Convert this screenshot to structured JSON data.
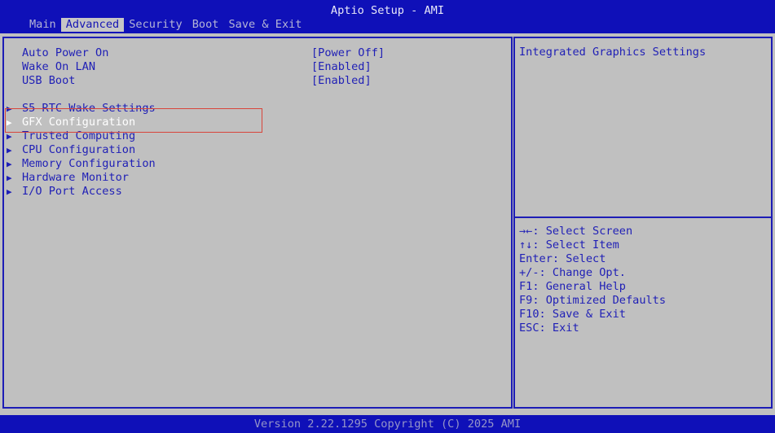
{
  "title": "Aptio Setup - AMI",
  "menu": [
    {
      "label": "Main",
      "active": false
    },
    {
      "label": "Advanced",
      "active": true
    },
    {
      "label": "Security",
      "active": false
    },
    {
      "label": "Boot",
      "active": false
    },
    {
      "label": "Save & Exit",
      "active": false
    }
  ],
  "settings": [
    {
      "label": "Auto Power On",
      "value": "[Power Off]"
    },
    {
      "label": "Wake On LAN",
      "value": "[Enabled]"
    },
    {
      "label": "USB Boot",
      "value": "[Enabled]"
    }
  ],
  "submenus": [
    {
      "label": "S5 RTC Wake Settings",
      "selected": false
    },
    {
      "label": "GFX Configuration",
      "selected": true
    },
    {
      "label": "Trusted Computing",
      "selected": false
    },
    {
      "label": "CPU Configuration",
      "selected": false
    },
    {
      "label": "Memory Configuration",
      "selected": false
    },
    {
      "label": "Hardware Monitor",
      "selected": false
    },
    {
      "label": "I/O Port Access",
      "selected": false
    }
  ],
  "submenu_arrow": "▶",
  "help": {
    "description": "Integrated Graphics Settings",
    "keys": [
      "→←: Select Screen",
      "↑↓: Select Item",
      "Enter: Select",
      "+/-: Change Opt.",
      "F1: General Help",
      "F9: Optimized Defaults",
      "F10: Save & Exit",
      "ESC: Exit"
    ]
  },
  "footer": "Version 2.22.1295 Copyright (C) 2025 AMI",
  "colors": {
    "bar_blue": "#0f10b8",
    "text_blue": "#1f1fb6",
    "background_gray": "#c0c0c0",
    "selected_text": "#ffffff",
    "selection_outline": "#d8453b"
  }
}
